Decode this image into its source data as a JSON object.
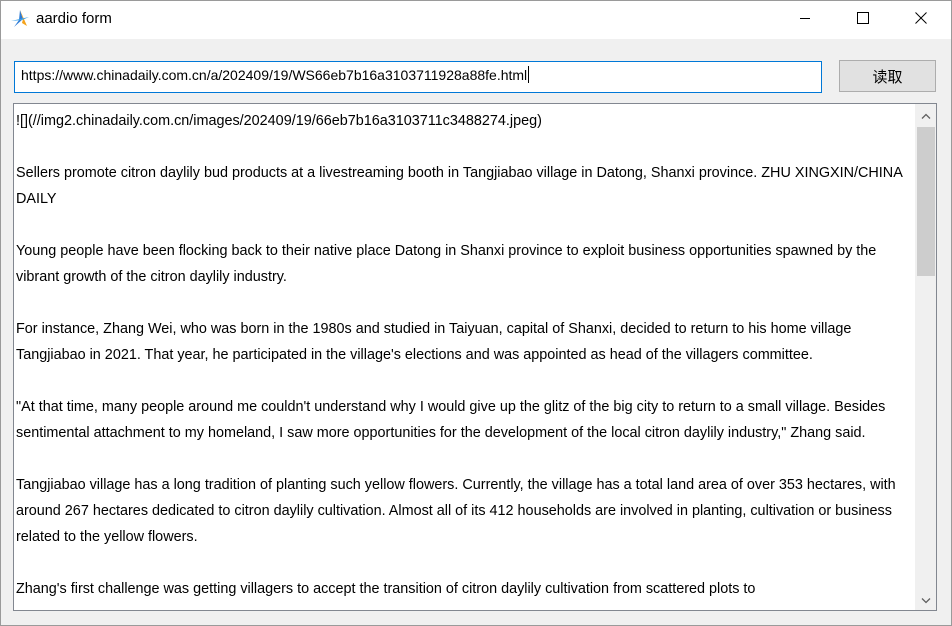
{
  "window": {
    "title": "aardio form",
    "icons": {
      "app": "aardio-app-icon",
      "minimize": "minimize-icon",
      "maximize": "maximize-icon",
      "close": "close-icon"
    }
  },
  "toolbar": {
    "url_value": "https://www.chinadaily.com.cn/a/202409/19/WS66eb7b16a3103711928a88fe.html",
    "read_label": "读取"
  },
  "content": {
    "paragraphs": [
      "![](//img2.chinadaily.com.cn/images/202409/19/66eb7b16a3103711c3488274.jpeg)",
      "Sellers promote citron daylily bud products at a livestreaming booth in Tangjiabao village in Datong, Shanxi province. ZHU XINGXIN/CHINA DAILY",
      "Young people have been flocking back to their native place Datong in Shanxi province to exploit business opportunities spawned by the vibrant growth of the citron daylily industry.",
      "For instance, Zhang Wei, who was born in the 1980s and studied in Taiyuan, capital of Shanxi, decided to return to his home village Tangjiabao in 2021. That year, he participated in the village's elections and was appointed as head of the villagers committee.",
      "\"At that time, many people around me couldn't understand why I would give up the glitz of the big city to return to a small village. Besides sentimental attachment to my homeland, I saw more opportunities for the development of the local citron daylily industry,\" Zhang said.",
      "Tangjiabao village has a long tradition of planting such yellow flowers. Currently, the village has a total land area of over 353 hectares, with around 267 hectares dedicated to citron daylily cultivation. Almost all of its 412 households are involved in planting, cultivation or business related to the yellow flowers.",
      "Zhang's first challenge was getting villagers to accept the transition of citron daylily cultivation from scattered plots to"
    ]
  },
  "scrollbar": {
    "up_icon": "scroll-up-arrow-icon",
    "down_icon": "scroll-down-arrow-icon",
    "position": 0.0
  }
}
